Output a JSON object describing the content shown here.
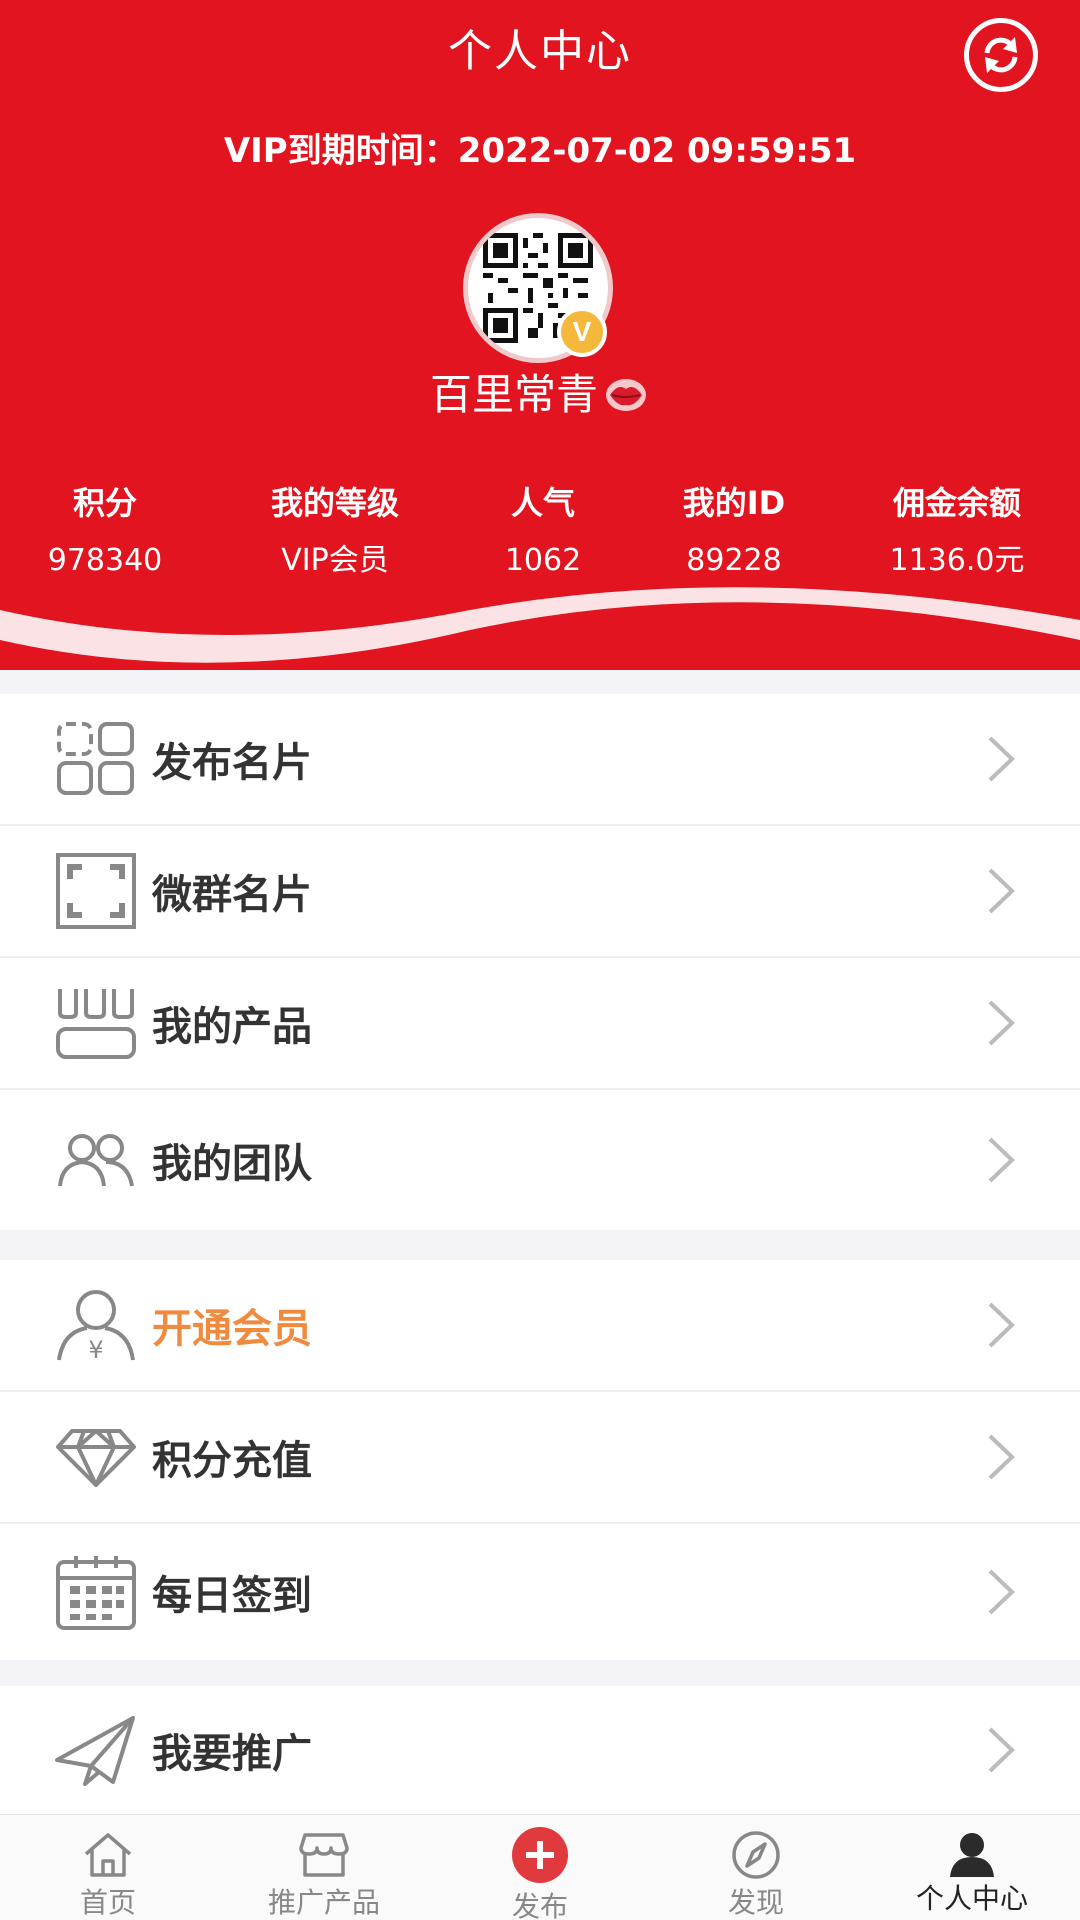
{
  "header": {
    "title": "个人中心",
    "vip_expiry": "VIP到期时间：2022-07-02 09:59:51",
    "username": "百里常青",
    "badge": "V",
    "accent_color": "#e1141f"
  },
  "stats": [
    {
      "label": "积分",
      "value": "978340"
    },
    {
      "label": "我的等级",
      "value": "VIP会员"
    },
    {
      "label": "人气",
      "value": "1062"
    },
    {
      "label": "我的ID",
      "value": "89228"
    },
    {
      "label": "佣金余额",
      "value": "1136.0元"
    }
  ],
  "menu": {
    "group1": [
      {
        "label": "发布名片",
        "icon": "grid-icon"
      },
      {
        "label": "微群名片",
        "icon": "scan-frame-icon"
      },
      {
        "label": "我的产品",
        "icon": "products-icon"
      },
      {
        "label": "我的团队",
        "icon": "team-icon"
      }
    ],
    "group2": [
      {
        "label": "开通会员",
        "icon": "member-icon",
        "highlight_color": "#f08a3e"
      },
      {
        "label": "积分充值",
        "icon": "diamond-icon"
      },
      {
        "label": "每日签到",
        "icon": "calendar-icon"
      }
    ],
    "group3": [
      {
        "label": "我要推广",
        "icon": "paper-plane-icon"
      }
    ]
  },
  "tabs": [
    {
      "label": "首页",
      "icon": "home-icon"
    },
    {
      "label": "推广产品",
      "icon": "store-icon"
    },
    {
      "label": "发布",
      "icon": "plus-circle-icon"
    },
    {
      "label": "发现",
      "icon": "compass-icon"
    },
    {
      "label": "个人中心",
      "icon": "user-icon",
      "active": true
    }
  ]
}
